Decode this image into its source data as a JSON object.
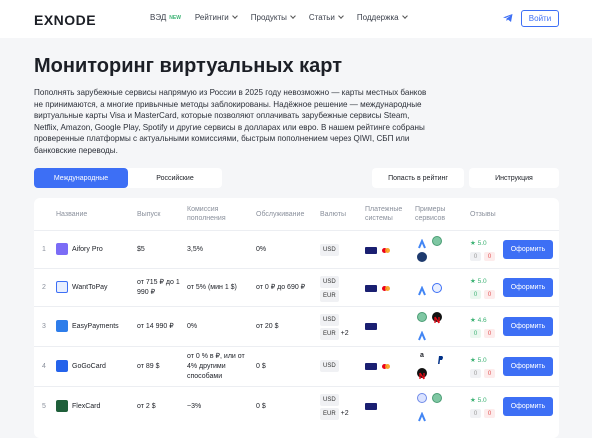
{
  "header": {
    "logo": "EXNODE",
    "nav": [
      {
        "label": "ВЭД",
        "badge": "NEW"
      },
      {
        "label": "Рейтинги",
        "dropdown": true
      },
      {
        "label": "Продукты",
        "dropdown": true
      },
      {
        "label": "Статьи",
        "dropdown": true
      },
      {
        "label": "Поддержка",
        "dropdown": true
      }
    ],
    "login": "Войти"
  },
  "page": {
    "title": "Мониторинг виртуальных карт",
    "description": "Пополнять зарубежные сервисы напрямую из России в 2025 году невозможно — карты местных банков не принимаются, а многие привычные методы заблокированы. Надёжное решение — международные виртуальные карты Visa и MasterCard, которые позволяют оплачивать зарубежные сервисы Steam, Netflix, Amazon, Google Play, Spotify и другие сервисы в долларах или евро. В нашем рейтинге собраны проверенные платформы с актуальными комиссиями, быстрым пополнением через QIWI, СБП или банковские переводы."
  },
  "tabs": [
    {
      "label": "Международные",
      "active": true
    },
    {
      "label": "Российские",
      "active": false
    }
  ],
  "actions": {
    "add": "Попасть в рейтинг",
    "guide": "Инструкция"
  },
  "table": {
    "headers": [
      "Название",
      "Выпуск",
      "Комиссия пополнения",
      "Обслуживание",
      "Валюты",
      "Платежные системы",
      "Примеры сервисов",
      "Отзывы"
    ],
    "rows": [
      {
        "n": "1",
        "name": "Aifory Pro",
        "issue": "$5",
        "fee": "3,5%",
        "service": "0%",
        "currencies": [
          "USD"
        ],
        "extra": "",
        "rating": "5.0",
        "pos": "0",
        "neg": "0",
        "button": "Оформить",
        "color": "#7b6cf6"
      },
      {
        "n": "2",
        "name": "WantToPay",
        "issue": "от 715 ₽ до 1 990 ₽",
        "fee": "от 5% (мин 1 $)",
        "service": "от 0 ₽ до 690 ₽",
        "currencies": [
          "USD",
          "EUR"
        ],
        "extra": "",
        "rating": "5.0",
        "pos": "0",
        "neg": "0",
        "button": "Оформить",
        "color": "#3d6ff5"
      },
      {
        "n": "3",
        "name": "EasyPayments",
        "issue": "от 14 990 ₽",
        "fee": "0%",
        "service": "от 20 $",
        "currencies": [
          "USD",
          "EUR"
        ],
        "extra": "+2",
        "rating": "4.6",
        "pos": "0",
        "neg": "0",
        "button": "Оформить",
        "color": "#2e7dea"
      },
      {
        "n": "4",
        "name": "GoGoCard",
        "issue": "от 89 $",
        "fee": "от 0 % в ₽, или от 4% другими способами",
        "service": "0 $",
        "currencies": [
          "USD"
        ],
        "extra": "",
        "rating": "5.0",
        "pos": "0",
        "neg": "0",
        "button": "Оформить",
        "color": "#2563eb"
      },
      {
        "n": "5",
        "name": "FlexCard",
        "issue": "от 2 $",
        "fee": "~3%",
        "service": "0 $",
        "currencies": [
          "USD",
          "EUR"
        ],
        "extra": "+2",
        "rating": "5.0",
        "pos": "0",
        "neg": "0",
        "button": "Оформить",
        "color": "#1f5f3a"
      }
    ]
  }
}
